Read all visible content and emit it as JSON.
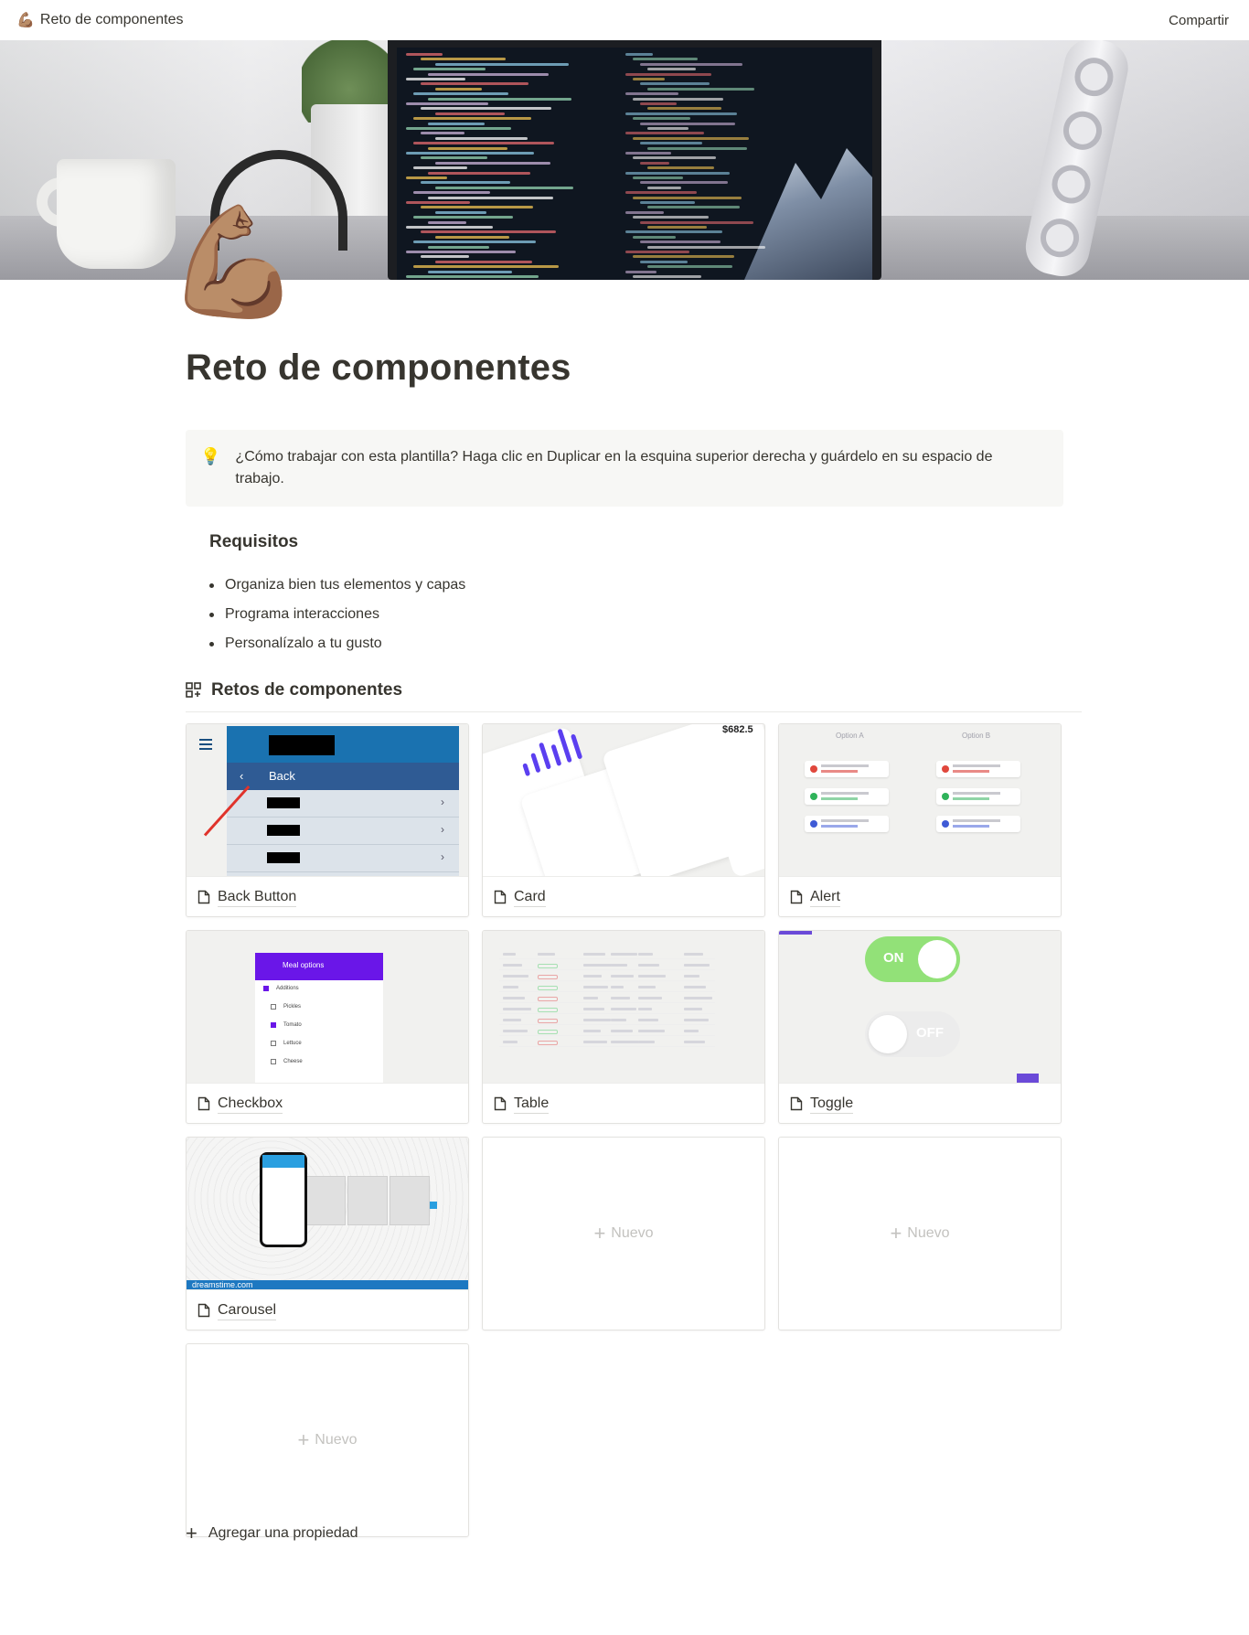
{
  "topbar": {
    "page_icon": "💪🏽",
    "breadcrumb": "Reto de componentes",
    "share_label": "Compartir"
  },
  "page": {
    "icon": "💪🏽",
    "title": "Reto de componentes"
  },
  "callout": {
    "icon": "💡",
    "text": "¿Cómo trabajar con esta plantilla? Haga clic en Duplicar en la esquina superior derecha y guárdelo en su espacio de trabajo."
  },
  "requirements": {
    "heading": "Requisitos",
    "items": [
      "Organiza bien tus elementos y capas",
      "Programa interacciones",
      "Personalízalo a tu gusto"
    ]
  },
  "database": {
    "icon": "gallery-icon",
    "title": "Retos de componentes",
    "cards": [
      {
        "name": "Back Button",
        "thumb": "back-button"
      },
      {
        "name": "Card",
        "thumb": "card"
      },
      {
        "name": "Alert",
        "thumb": "alert"
      },
      {
        "name": "Checkbox",
        "thumb": "checkbox"
      },
      {
        "name": "Table",
        "thumb": "table"
      },
      {
        "name": "Toggle",
        "thumb": "toggle"
      },
      {
        "name": "Carousel",
        "thumb": "carousel"
      }
    ],
    "new_label": "Nuevo",
    "thumb_text": {
      "back": "Back",
      "card_price": "$682.5",
      "alert_option_a": "Option A",
      "alert_option_b": "Option B",
      "checkbox_header": "Meal options",
      "checkbox_options": [
        "Additions",
        "Pickles",
        "Tomato",
        "Lettuce",
        "Cheese"
      ],
      "toggle_on": "ON",
      "toggle_off": "OFF",
      "carousel_footer": "dreamstime.com"
    }
  },
  "footer": {
    "add_property_label": "Agregar una propiedad"
  },
  "colors": {
    "text": "#37352f",
    "callout_bg": "#f7f7f5",
    "muted": "#c3c2bf",
    "toggle_on": "#92e178",
    "accent_purple": "#6a16e8"
  }
}
